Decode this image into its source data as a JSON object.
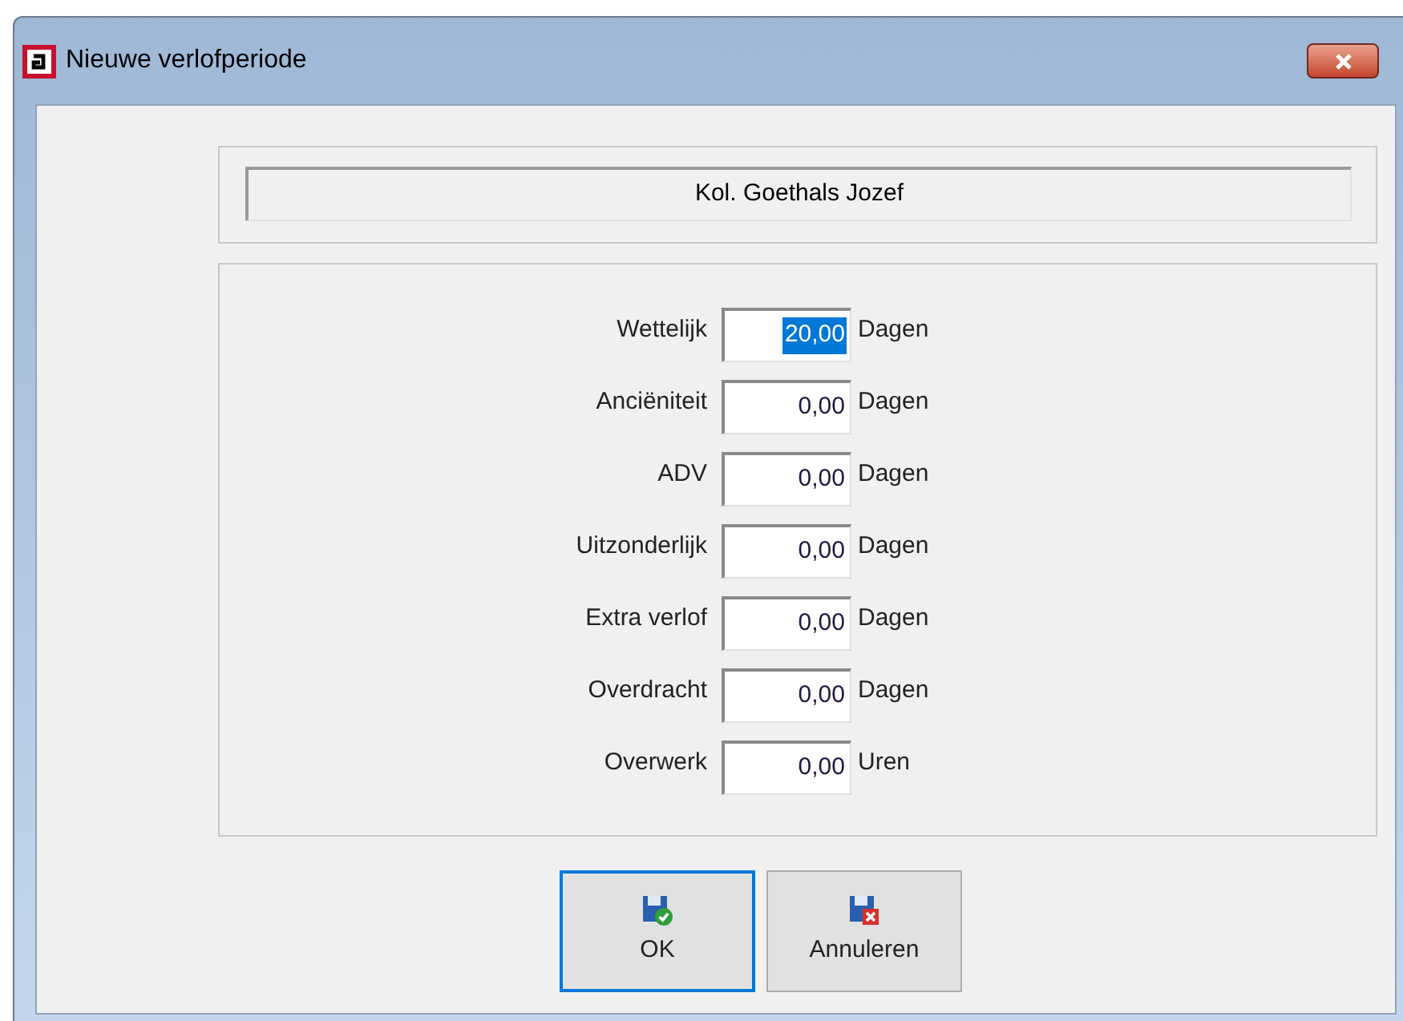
{
  "window": {
    "title": "Nieuwe verlofperiode"
  },
  "employee": {
    "name": "Kol. Goethals Jozef"
  },
  "fields": [
    {
      "label": "Wettelijk",
      "value": "20,00",
      "unit": "Dagen",
      "selected": true
    },
    {
      "label": "Anciëniteit",
      "value": "0,00",
      "unit": "Dagen",
      "selected": false
    },
    {
      "label": "ADV",
      "value": "0,00",
      "unit": "Dagen",
      "selected": false
    },
    {
      "label": "Uitzonderlijk",
      "value": "0,00",
      "unit": "Dagen",
      "selected": false
    },
    {
      "label": "Extra verlof",
      "value": "0,00",
      "unit": "Dagen",
      "selected": false
    },
    {
      "label": "Overdracht",
      "value": "0,00",
      "unit": "Dagen",
      "selected": false
    },
    {
      "label": "Overwerk",
      "value": "0,00",
      "unit": "Uren",
      "selected": false
    }
  ],
  "buttons": [
    {
      "label": "OK",
      "kind": "ok",
      "default": true
    },
    {
      "label": "Annuleren",
      "kind": "cancel",
      "default": false
    }
  ]
}
